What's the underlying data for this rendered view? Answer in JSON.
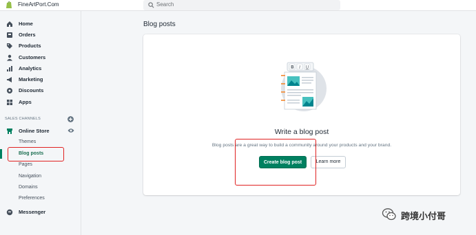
{
  "store": {
    "name": "FineArtPort.Com"
  },
  "search": {
    "placeholder": "Search"
  },
  "sidebar": {
    "items": [
      {
        "label": "Home",
        "icon": "home-icon"
      },
      {
        "label": "Orders",
        "icon": "orders-icon"
      },
      {
        "label": "Products",
        "icon": "tag-icon"
      },
      {
        "label": "Customers",
        "icon": "person-icon"
      },
      {
        "label": "Analytics",
        "icon": "bar-chart-icon"
      },
      {
        "label": "Marketing",
        "icon": "megaphone-icon"
      },
      {
        "label": "Discounts",
        "icon": "gear-discount-icon"
      },
      {
        "label": "Apps",
        "icon": "apps-icon"
      }
    ],
    "channels_heading": "SALES CHANNELS",
    "online_store": {
      "label": "Online Store",
      "icon": "store-icon"
    },
    "sub_items": [
      {
        "label": "Themes"
      },
      {
        "label": "Blog posts",
        "active": true
      },
      {
        "label": "Pages"
      },
      {
        "label": "Navigation"
      },
      {
        "label": "Domains"
      },
      {
        "label": "Preferences"
      }
    ],
    "messenger": {
      "label": "Messenger",
      "icon": "chat-icon"
    }
  },
  "main": {
    "title": "Blog posts",
    "empty_state": {
      "heading": "Write a blog post",
      "description": "Blog posts are a great way to build a community around your products and your brand.",
      "primary_label": "Create blog post",
      "secondary_label": "Learn more"
    }
  },
  "watermark": {
    "text": "跨境小付哥"
  },
  "colors": {
    "accent": "#008060",
    "highlight": "#e02020"
  }
}
